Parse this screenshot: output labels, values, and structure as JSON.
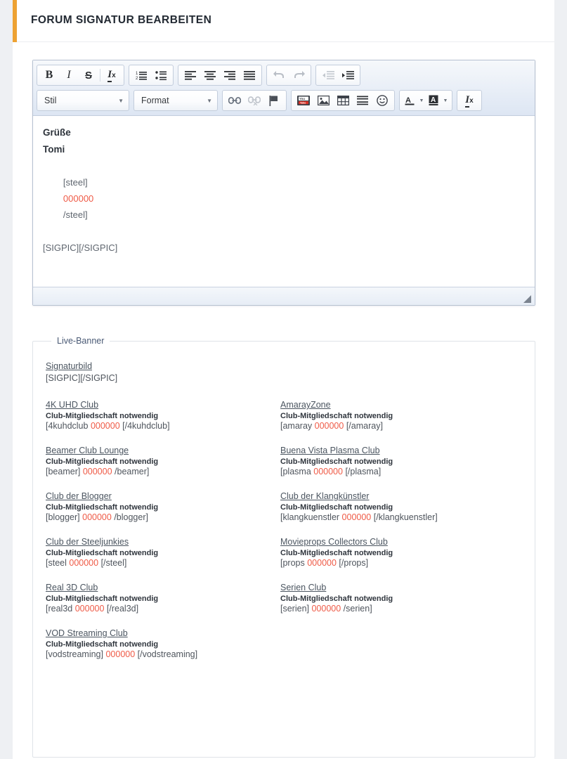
{
  "header": {
    "title": "FORUM SIGNATUR BEARBEITEN",
    "accent_color": "#eda233"
  },
  "editor": {
    "toolbar": {
      "row1": [
        {
          "name": "bold-icon",
          "label": "B"
        },
        {
          "name": "italic-icon",
          "label": "I"
        },
        {
          "name": "strikethrough-icon",
          "label": "S"
        },
        {
          "name": "remove-format-icon",
          "label": "Ix"
        },
        {
          "name": "numbered-list-icon",
          "label": "1= 2="
        },
        {
          "name": "bulleted-list-icon",
          "label": ":="
        },
        {
          "name": "align-left-icon",
          "label": "align-left"
        },
        {
          "name": "align-center-icon",
          "label": "align-center"
        },
        {
          "name": "align-right-icon",
          "label": "align-right"
        },
        {
          "name": "align-justify-icon",
          "label": "align-justify"
        },
        {
          "name": "undo-icon",
          "label": "undo"
        },
        {
          "name": "redo-icon",
          "label": "redo"
        },
        {
          "name": "outdent-icon",
          "label": "outdent"
        },
        {
          "name": "indent-icon",
          "label": "indent"
        }
      ],
      "style_select": {
        "label": "Stil"
      },
      "format_select": {
        "label": "Format"
      },
      "row2": [
        {
          "name": "link-icon",
          "label": "link"
        },
        {
          "name": "unlink-icon",
          "label": "unlink"
        },
        {
          "name": "anchor-flag-icon",
          "label": "flag"
        },
        {
          "name": "youtube-icon",
          "label": "YouTube"
        },
        {
          "name": "image-icon",
          "label": "image"
        },
        {
          "name": "table-icon",
          "label": "table"
        },
        {
          "name": "horizontal-rule-icon",
          "label": "hr"
        },
        {
          "name": "smiley-icon",
          "label": "smiley"
        },
        {
          "name": "text-color-icon",
          "label": "A"
        },
        {
          "name": "background-color-icon",
          "label": "A"
        },
        {
          "name": "remove-format-2-icon",
          "label": "Ix"
        }
      ]
    },
    "content": {
      "line1": "Grüße",
      "line2": "Tomi",
      "line3_prefix": "[steel]",
      "line3_color": "000000",
      "line3_suffix": "/steel]",
      "line4": "[SIGPIC][/SIGPIC]"
    }
  },
  "live_banner": {
    "legend": "Live-Banner",
    "signature_image": {
      "link_label": "Signaturbild",
      "code": "[SIGPIC][/SIGPIC]"
    },
    "membership_note": "Club-Mitgliedschaft notwendig",
    "clubs": [
      {
        "link_label": "4K UHD Club",
        "note": "Club-Mitgliedschaft notwendig",
        "code_open": "[4kuhdclub",
        "code_color": "000000",
        "code_close": "[/4kuhdclub]"
      },
      {
        "link_label": "AmarayZone",
        "note": "Club-Mitgliedschaft notwendig",
        "code_open": "[amaray",
        "code_color": "000000",
        "code_close": "[/amaray]"
      },
      {
        "link_label": "Beamer Club Lounge",
        "note": "Club-Mitgliedschaft notwendig",
        "code_open": "[beamer]",
        "code_color": "000000",
        "code_close": "/beamer]"
      },
      {
        "link_label": "Buena Vista Plasma Club",
        "note": "Club-Mitgliedschaft notwendig",
        "code_open": "[plasma",
        "code_color": "000000",
        "code_close": "[/plasma]"
      },
      {
        "link_label": "Club der Blogger",
        "note": "Club-Mitgliedschaft notwendig",
        "code_open": "[blogger]",
        "code_color": "000000",
        "code_close": "/blogger]"
      },
      {
        "link_label": "Club der Klangkünstler",
        "note": "Club-Mitgliedschaft notwendig",
        "code_open": "[klangkuenstler",
        "code_color": "000000",
        "code_close": "[/klangkuenstler]"
      },
      {
        "link_label": "Club der Steeljunkies",
        "note": "Club-Mitgliedschaft notwendig",
        "code_open": "[steel",
        "code_color": "000000",
        "code_close": "[/steel]"
      },
      {
        "link_label": "Movieprops Collectors Club",
        "note": "Club-Mitgliedschaft notwendig",
        "code_open": "[props",
        "code_color": "000000",
        "code_close": "[/props]"
      },
      {
        "link_label": "Real 3D Club",
        "note": "Club-Mitgliedschaft notwendig",
        "code_open": "[real3d",
        "code_color": "000000",
        "code_close": "[/real3d]"
      },
      {
        "link_label": "Serien Club",
        "note": "Club-Mitgliedschaft notwendig",
        "code_open": "[serien]",
        "code_color": "000000",
        "code_close": "/serien]"
      },
      {
        "link_label": "VOD Streaming Club",
        "note": "Club-Mitgliedschaft notwendig",
        "code_open": "[vodstreaming]",
        "code_color": "000000",
        "code_close": "[/vodstreaming]"
      }
    ]
  }
}
